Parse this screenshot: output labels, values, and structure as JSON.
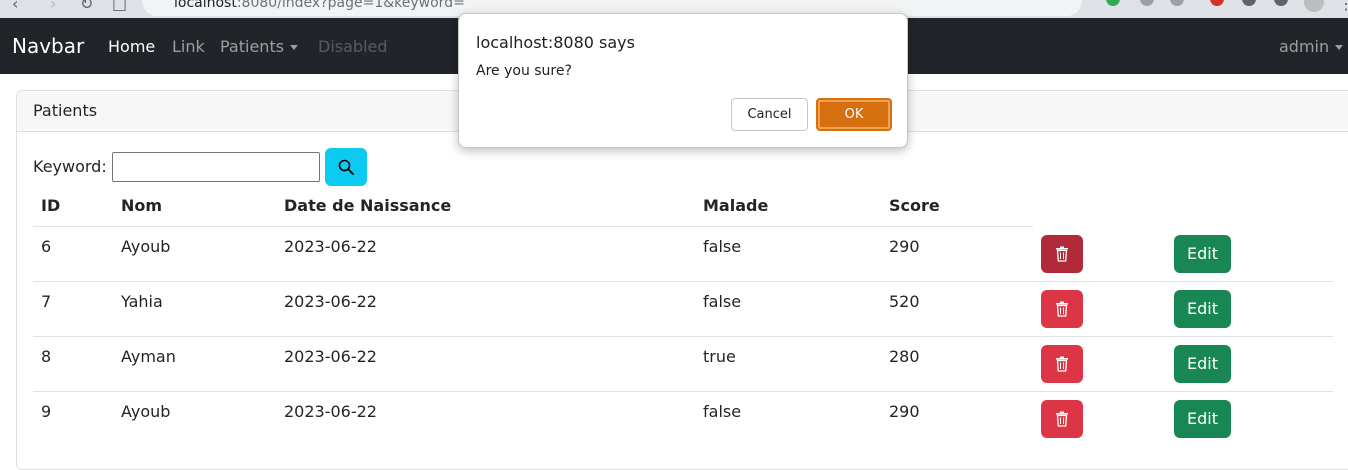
{
  "browser": {
    "url_host": "localhost",
    "url_rest": ":8080/index?page=1&keyword="
  },
  "navbar": {
    "brand": "Navbar",
    "links": [
      {
        "label": "Home"
      },
      {
        "label": "Link"
      },
      {
        "label": "Patients"
      },
      {
        "label": "Disabled"
      }
    ],
    "user": "admin"
  },
  "card": {
    "header": "Patients",
    "keyword_label": "Keyword:",
    "keyword_value": ""
  },
  "table": {
    "columns": [
      "ID",
      "Nom",
      "Date de Naissance",
      "Malade",
      "Score"
    ],
    "edit_label": "Edit",
    "rows": [
      {
        "id": "6",
        "nom": "Ayoub",
        "date": "2023-06-22",
        "malade": "false",
        "score": "290"
      },
      {
        "id": "7",
        "nom": "Yahia",
        "date": "2023-06-22",
        "malade": "false",
        "score": "520"
      },
      {
        "id": "8",
        "nom": "Ayman",
        "date": "2023-06-22",
        "malade": "true",
        "score": "280"
      },
      {
        "id": "9",
        "nom": "Ayoub",
        "date": "2023-06-22",
        "malade": "false",
        "score": "290"
      }
    ]
  },
  "dialog": {
    "title": "localhost:8080 says",
    "message": "Are you sure?",
    "cancel_label": "Cancel",
    "ok_label": "OK"
  },
  "colors": {
    "navbar_bg": "#212529",
    "search_btn": "#0dcaf0",
    "delete_btn": "#dc3545",
    "edit_btn": "#198754",
    "dialog_ok": "#d56f10"
  },
  "icons": [
    "search-icon",
    "trash-icon",
    "back-arrow-icon",
    "forward-arrow-icon",
    "reload-icon",
    "caret-down-icon"
  ]
}
